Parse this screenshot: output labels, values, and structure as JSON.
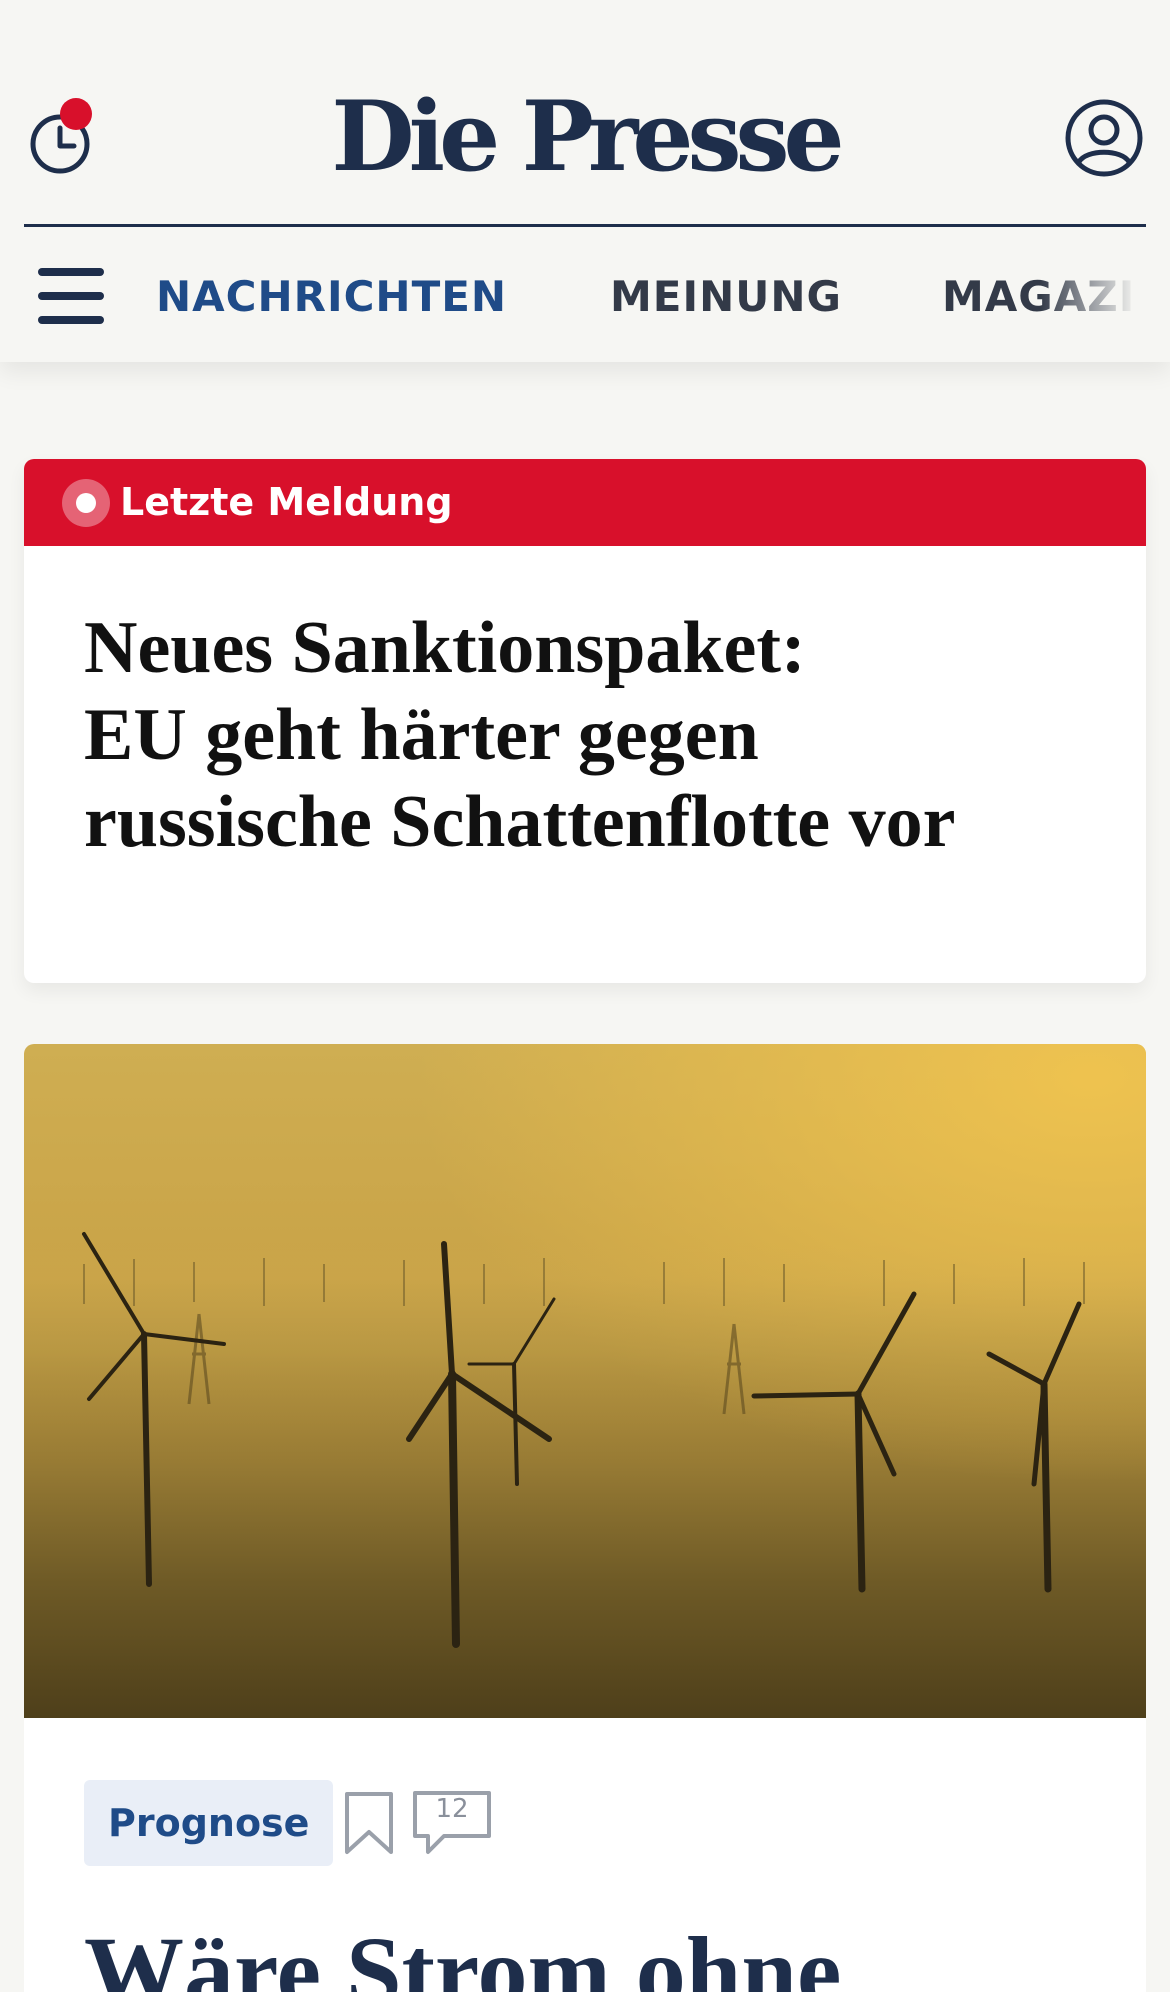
{
  "header": {
    "logo": "Die Presse",
    "nav": [
      {
        "label": "NACHRICHTEN",
        "active": true
      },
      {
        "label": "MEINUNG",
        "active": false
      },
      {
        "label": "MAGAZIN",
        "active": false
      }
    ],
    "history_icon": "clock-icon",
    "account_icon": "user-circle-icon",
    "menu_icon": "hamburger-menu-icon"
  },
  "breaking": {
    "label": "Letzte Meldung",
    "headline_lines": [
      "Neues Sanktionspaket:",
      "EU geht härter gegen",
      "russische Schattenflotte vor"
    ],
    "icon": "live-indicator-icon"
  },
  "lead_article": {
    "tag": "Prognose",
    "comment_count": "12",
    "title": "Wäre Strom ohne",
    "bookmark_icon": "bookmark-icon",
    "comment_icon": "comment-bubble-icon"
  },
  "colors": {
    "brand_navy": "#1e2e4b",
    "nav_active": "#1f4b88",
    "breaking_red": "#d8102b",
    "notification_dot": "#d8102b",
    "background": "#f6f6f3"
  }
}
